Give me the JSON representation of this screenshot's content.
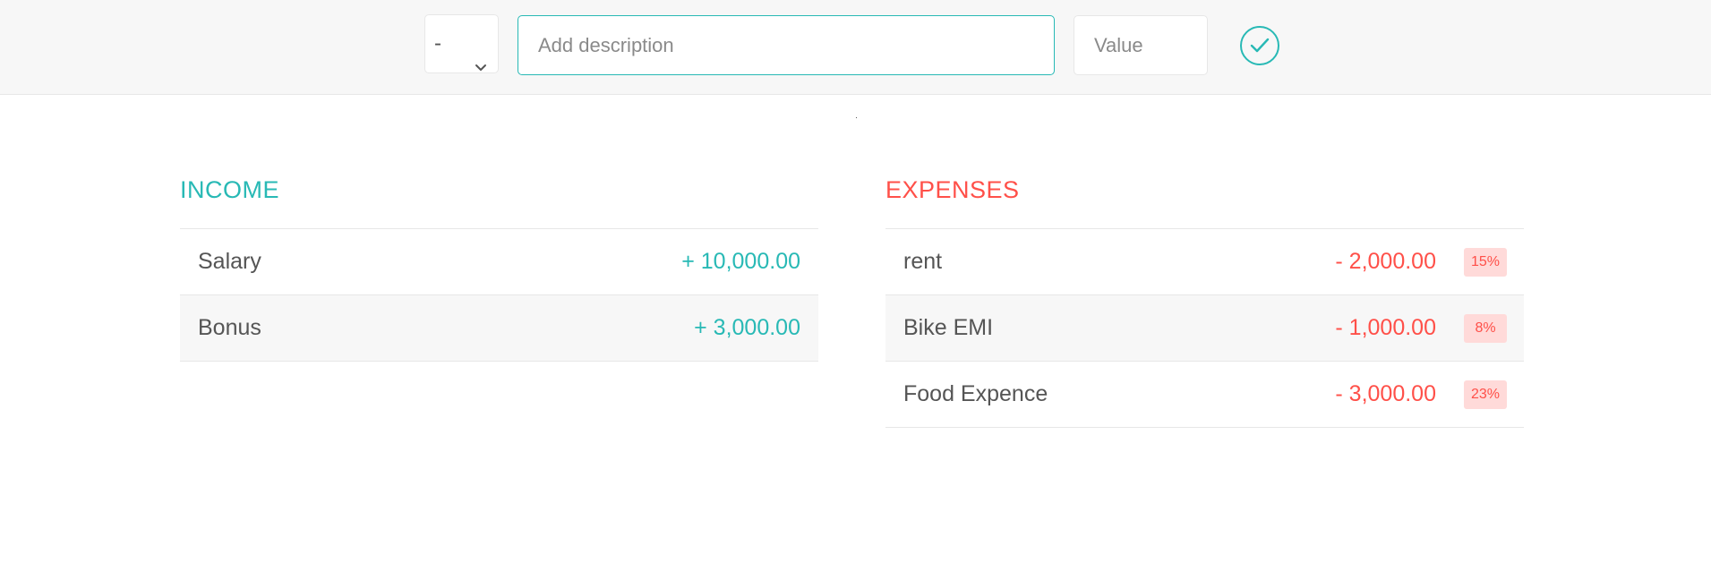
{
  "add_bar": {
    "type_value": "-",
    "description_placeholder": "Add description",
    "value_placeholder": "Value"
  },
  "income": {
    "title": "INCOME",
    "items": [
      {
        "description": "Salary",
        "value": "+ 10,000.00"
      },
      {
        "description": "Bonus",
        "value": "+ 3,000.00"
      }
    ]
  },
  "expenses": {
    "title": "EXPENSES",
    "items": [
      {
        "description": "rent",
        "value": "- 2,000.00",
        "percentage": "15%"
      },
      {
        "description": "Bike EMI",
        "value": "- 1,000.00",
        "percentage": "8%"
      },
      {
        "description": "Food Expence",
        "value": "- 3,000.00",
        "percentage": "23%"
      }
    ]
  },
  "colors": {
    "income": "#28b9b5",
    "expense": "#ff5049",
    "percentage_bg": "#ffdad9"
  },
  "icons": {
    "add_button": "checkmark-circle-icon",
    "select_arrow": "chevron-down-icon"
  }
}
